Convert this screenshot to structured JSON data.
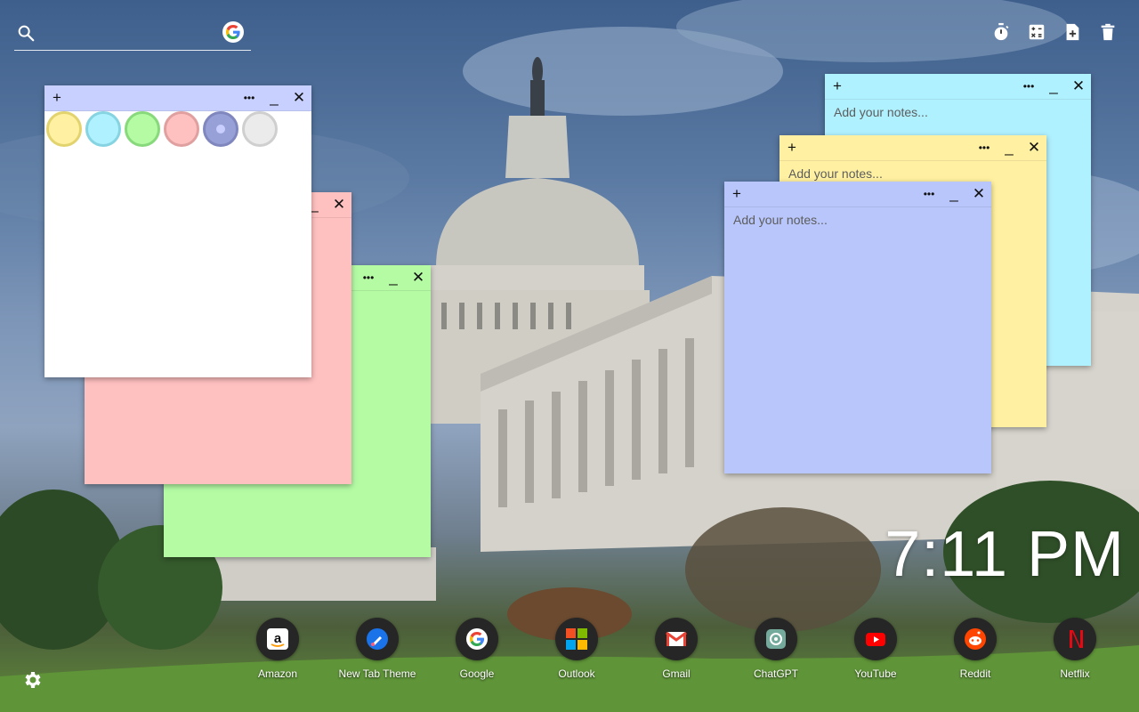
{
  "search": {
    "value": "",
    "placeholder": ""
  },
  "toolbar": {
    "icons": [
      "stopwatch-icon",
      "calculator-icon",
      "add-note-icon",
      "trash-icon"
    ]
  },
  "notes": {
    "placeholder": "Add your notes...",
    "add_label": "+",
    "menu_label": "•••",
    "minimize_label": "_",
    "close_label": "✕"
  },
  "palette": {
    "colors": [
      {
        "name": "yellow",
        "fill": "#fff1a1",
        "border": "#e3d36f"
      },
      {
        "name": "cyan",
        "fill": "#b0f1ff",
        "border": "#86d4e2"
      },
      {
        "name": "green",
        "fill": "#b4fba4",
        "border": "#88d97b"
      },
      {
        "name": "pink",
        "fill": "#ffc0c0",
        "border": "#e0a0a0"
      },
      {
        "name": "lavender",
        "fill": "#b8c0f8",
        "border": "#8a92c8"
      },
      {
        "name": "white",
        "fill": "#ffffff",
        "border": "#cfcfcf"
      }
    ]
  },
  "colors": {
    "white_note": "#ffffff",
    "pink_note": "#ffc0c0",
    "green_note": "#b4fba4",
    "cyan_note": "#b0f1ff",
    "yellow_note": "#fff1a1",
    "lavender_note": "#b8c6fb",
    "bar_white": "#c7d0ff"
  },
  "clock": {
    "time": "7:11 PM"
  },
  "shortcuts": [
    {
      "label": "Amazon",
      "icon": "amazon-icon"
    },
    {
      "label": "New Tab Theme",
      "icon": "brush-icon"
    },
    {
      "label": "Google",
      "icon": "google-icon"
    },
    {
      "label": "Outlook",
      "icon": "microsoft-icon"
    },
    {
      "label": "Gmail",
      "icon": "gmail-icon"
    },
    {
      "label": "ChatGPT",
      "icon": "chatgpt-icon"
    },
    {
      "label": "YouTube",
      "icon": "youtube-icon"
    },
    {
      "label": "Reddit",
      "icon": "reddit-icon"
    },
    {
      "label": "Netflix",
      "icon": "netflix-icon"
    }
  ]
}
